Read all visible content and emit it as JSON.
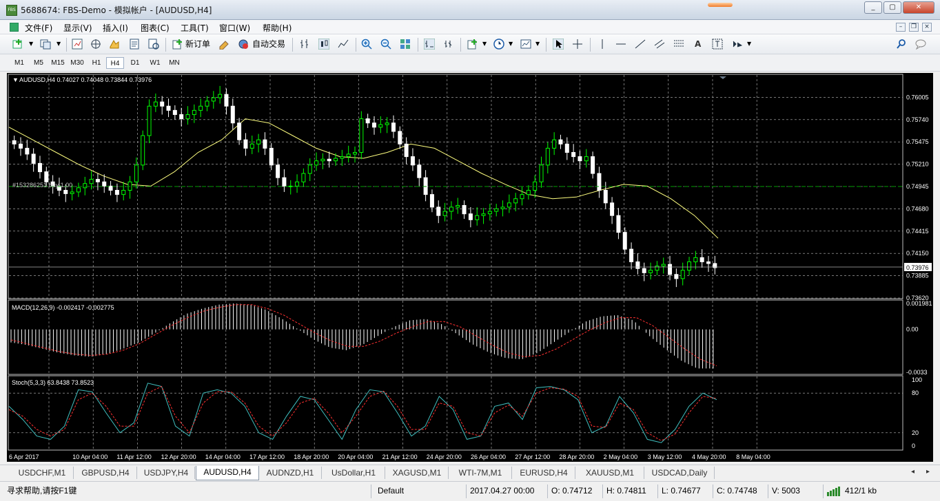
{
  "window": {
    "title": "5688674: FBS-Demo - 模拟帐户 - [AUDUSD,H4]",
    "app_icon": "FBS"
  },
  "menu": {
    "items": [
      "文件(F)",
      "显示(V)",
      "插入(I)",
      "图表(C)",
      "工具(T)",
      "窗口(W)",
      "帮助(H)"
    ]
  },
  "toolbar": {
    "new_order": "新订单",
    "auto_trading": "自动交易"
  },
  "timeframes": {
    "items": [
      "M1",
      "M5",
      "M15",
      "M30",
      "H1",
      "H4",
      "D1",
      "W1",
      "MN"
    ],
    "active": "H4"
  },
  "chart": {
    "header": "AUDUSD,H4  0.74027 0.74048 0.73844 0.73976",
    "order_label": "#153286251 buy 1.00",
    "bid_label": "0.73976",
    "price_ticks": [
      "0.76005",
      "0.75740",
      "0.75475",
      "0.75210",
      "0.74945",
      "0.74680",
      "0.74415",
      "0.74150",
      "0.73885",
      "0.73620"
    ],
    "time_ticks": [
      "6 Apr 2017",
      "10 Apr 04:00",
      "11 Apr 12:00",
      "12 Apr 20:00",
      "14 Apr 04:00",
      "17 Apr 12:00",
      "18 Apr 20:00",
      "20 Apr 04:00",
      "21 Apr 12:00",
      "24 Apr 20:00",
      "26 Apr 04:00",
      "27 Apr 12:00",
      "28 Apr 20:00",
      "2 May 04:00",
      "3 May 12:00",
      "4 May 20:00",
      "8 May 04:00"
    ],
    "macd_header": "MACD(12,26,9) -0.002417 -0.002775",
    "macd_ticks": [
      "0.001981",
      "0.00",
      "-0.0033"
    ],
    "stoch_header": "Stoch(5,3,3) 63.8438 73.8523",
    "stoch_ticks": [
      "100",
      "80",
      "20",
      "0"
    ],
    "colors": {
      "bull": "#00ff00",
      "bear": "#ffffff",
      "ma": "#ffff80",
      "signal": "#ff3030",
      "stoch_main": "#40c0c0",
      "grid": "#c0c0c0",
      "order_line": "#00a000"
    }
  },
  "chart_data": {
    "type": "candlestick",
    "symbol": "AUDUSD",
    "timeframe": "H4",
    "last": {
      "open": 0.74027,
      "high": 0.74048,
      "low": 0.73844,
      "close": 0.73976
    },
    "ylim": [
      0.7362,
      0.7627
    ],
    "note_close_path": [
      0.7545,
      0.754,
      0.7533,
      0.7522,
      0.7512,
      0.75,
      0.7495,
      0.749,
      0.7486,
      0.7488,
      0.7493,
      0.7498,
      0.7503,
      0.75,
      0.7495,
      0.749,
      0.7485,
      0.749,
      0.75,
      0.752,
      0.7555,
      0.759,
      0.7595,
      0.759,
      0.7585,
      0.758,
      0.7575,
      0.758,
      0.7585,
      0.759,
      0.7596,
      0.76,
      0.7604,
      0.759,
      0.757,
      0.755,
      0.754,
      0.7545,
      0.755,
      0.754,
      0.752,
      0.7505,
      0.7495,
      0.7495,
      0.75,
      0.751,
      0.752,
      0.7525,
      0.7527,
      0.7525,
      0.7528,
      0.753,
      0.7533,
      0.7535,
      0.7575,
      0.757,
      0.7565,
      0.7568,
      0.757,
      0.756,
      0.7545,
      0.753,
      0.752,
      0.7505,
      0.7485,
      0.747,
      0.746,
      0.7465,
      0.747,
      0.7472,
      0.7462,
      0.7455,
      0.746,
      0.7462,
      0.7465,
      0.7468,
      0.747,
      0.7475,
      0.748,
      0.7485,
      0.749,
      0.75,
      0.752,
      0.754,
      0.755,
      0.7545,
      0.7535,
      0.753,
      0.7525,
      0.753,
      0.751,
      0.749,
      0.7475,
      0.746,
      0.744,
      0.742,
      0.7405,
      0.7397,
      0.7392,
      0.7395,
      0.74,
      0.7402,
      0.739,
      0.7385,
      0.7395,
      0.7405,
      0.741,
      0.7405,
      0.7403,
      0.7398
    ],
    "ma_path": [
      0.7565,
      0.755,
      0.7535,
      0.752,
      0.7507,
      0.7497,
      0.7495,
      0.7512,
      0.7535,
      0.755,
      0.7575,
      0.757,
      0.7555,
      0.754,
      0.753,
      0.7528,
      0.7535,
      0.7545,
      0.754,
      0.7525,
      0.751,
      0.7497,
      0.7485,
      0.748,
      0.7482,
      0.749,
      0.7497,
      0.7495,
      0.748,
      0.746,
      0.7433
    ],
    "macd_hist": [
      -0.001,
      -0.0012,
      -0.0015,
      -0.0018,
      -0.002,
      -0.0021,
      -0.0019,
      -0.0015,
      -0.001,
      -0.0003,
      0.0005,
      0.0012,
      0.0016,
      0.0019,
      0.002,
      0.0019,
      0.0015,
      0.0008,
      0.0,
      -0.0008,
      -0.0014,
      -0.0016,
      -0.0012,
      -0.0005,
      0.0002,
      0.0007,
      0.0008,
      0.0004,
      -0.0004,
      -0.0012,
      -0.0018,
      -0.0022,
      -0.0023,
      -0.0018,
      -0.001,
      -0.0002,
      0.0006,
      0.001,
      0.0011,
      0.0007,
      -0.0005,
      -0.0015,
      -0.0024,
      -0.003,
      -0.003
    ],
    "macd_signal": [
      -0.0008,
      -0.0011,
      -0.0014,
      -0.0017,
      -0.0019,
      -0.002,
      -0.0019,
      -0.0016,
      -0.0011,
      -0.0004,
      0.0003,
      0.0009,
      0.0014,
      0.0017,
      0.0019,
      0.0019,
      0.0016,
      0.0011,
      0.0004,
      -0.0003,
      -0.0009,
      -0.0013,
      -0.0013,
      -0.0009,
      -0.0003,
      0.0002,
      0.0006,
      0.0006,
      0.0002,
      -0.0005,
      -0.0012,
      -0.0018,
      -0.0021,
      -0.002,
      -0.0015,
      -0.0008,
      -0.0001,
      0.0005,
      0.0009,
      0.0009,
      0.0003,
      -0.0006,
      -0.0015,
      -0.0023,
      -0.0028
    ],
    "stoch_main": [
      60,
      40,
      15,
      10,
      30,
      85,
      82,
      50,
      20,
      35,
      95,
      90,
      30,
      15,
      80,
      85,
      80,
      60,
      20,
      10,
      45,
      75,
      70,
      40,
      10,
      55,
      85,
      82,
      50,
      15,
      30,
      75,
      55,
      10,
      15,
      60,
      65,
      40,
      88,
      90,
      85,
      70,
      20,
      30,
      75,
      50,
      10,
      5,
      25,
      60,
      80,
      70
    ],
    "stoch_signal": [
      55,
      45,
      25,
      15,
      25,
      70,
      80,
      60,
      30,
      30,
      80,
      90,
      45,
      20,
      65,
      82,
      82,
      65,
      30,
      15,
      35,
      65,
      72,
      50,
      20,
      45,
      75,
      83,
      60,
      25,
      25,
      65,
      60,
      20,
      15,
      50,
      62,
      45,
      80,
      88,
      86,
      75,
      30,
      28,
      65,
      55,
      20,
      8,
      18,
      50,
      75,
      72
    ]
  },
  "symbol_tabs": {
    "items": [
      "USDCHF,M1",
      "GBPUSD,H4",
      "USDJPY,H4",
      "AUDUSD,H4",
      "AUDNZD,H1",
      "UsDollar,H1",
      "XAGUSD,M1",
      "WTI-7M,M1",
      "EURUSD,H4",
      "XAUUSD,M1",
      "USDCAD,Daily"
    ],
    "active": "AUDUSD,H4"
  },
  "status": {
    "help": "寻求帮助,请按F1键",
    "profile": "Default",
    "datetime": "2017.04.27 00:00",
    "open": "O: 0.74712",
    "high": "H: 0.74811",
    "low": "L: 0.74677",
    "close": "C: 0.74748",
    "volume": "V: 5003",
    "traffic": "412/1 kb"
  }
}
